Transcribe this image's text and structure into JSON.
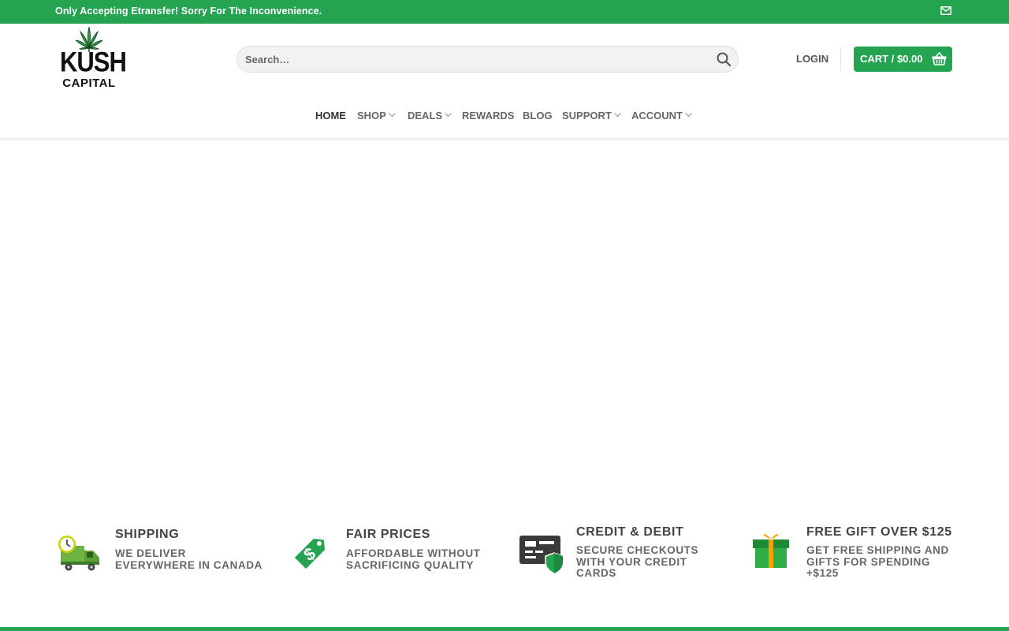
{
  "topbar": {
    "notice": "Only Accepting Etransfer! Sorry For The Inconvenience.",
    "mail_icon": "envelope-icon"
  },
  "logo": {
    "line1": "KUSH",
    "line2": "CAPITAL",
    "icon": "cannabis-leaf-icon"
  },
  "search": {
    "placeholder": "Search…",
    "icon": "search-icon"
  },
  "account": {
    "login_label": "LOGIN"
  },
  "cart": {
    "label": "CART / $0.00",
    "icon": "basket-icon"
  },
  "nav": {
    "items": [
      {
        "label": "HOME",
        "active": true,
        "dropdown": false
      },
      {
        "label": "SHOP",
        "active": false,
        "dropdown": true
      },
      {
        "label": "DEALS",
        "active": false,
        "dropdown": true
      },
      {
        "label": "REWARDS",
        "active": false,
        "dropdown": false
      },
      {
        "label": "BLOG",
        "active": false,
        "dropdown": false
      },
      {
        "label": "SUPPORT",
        "active": false,
        "dropdown": true
      },
      {
        "label": "ACCOUNT",
        "active": false,
        "dropdown": true
      }
    ]
  },
  "features": [
    {
      "title": "SHIPPING",
      "desc": [
        "WE DELIVER",
        "EVERYWHERE IN CANADA"
      ],
      "icon": "delivery-truck-icon"
    },
    {
      "title": "FAIR PRICES",
      "desc": [
        "AFFORDABLE WITHOUT",
        "SACRIFICING QUALITY"
      ],
      "icon": "price-tag-icon"
    },
    {
      "title": "CREDIT & DEBIT",
      "desc": [
        "SECURE CHECKOUTS",
        "WITH YOUR CREDIT",
        "CARDS"
      ],
      "icon": "secure-card-icon"
    },
    {
      "title": "FREE GIFT OVER $125",
      "desc": [
        "GET FREE SHIPPING AND",
        "GIFTS FOR SPENDING",
        "+$125"
      ],
      "icon": "gift-box-icon"
    }
  ],
  "colors": {
    "brand_green": "#24a350",
    "text_dark": "#333333",
    "text_mid": "#666666"
  }
}
